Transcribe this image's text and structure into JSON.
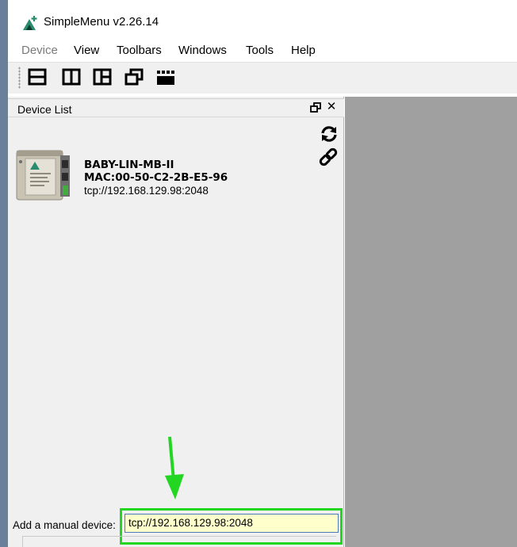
{
  "window": {
    "title": "SimpleMenu v2.26.14"
  },
  "menu": [
    {
      "label": "Device",
      "enabled": false
    },
    {
      "label": "View",
      "enabled": true
    },
    {
      "label": "Toolbars",
      "enabled": true
    },
    {
      "label": "Windows",
      "enabled": true
    },
    {
      "label": "Tools",
      "enabled": true
    },
    {
      "label": "Help",
      "enabled": true
    }
  ],
  "toolbar": {
    "icons": [
      "layout-horizontal-icon",
      "layout-vertical-icon",
      "layout-grid-icon",
      "cascade-windows-icon",
      "clapperboard-icon"
    ]
  },
  "device_list": {
    "title": "Device List",
    "close_glyph": "✕",
    "devices": [
      {
        "name": "BABY-LIN-MB-II",
        "mac": "MAC:00-50-C2-2B-E5-96",
        "address": "tcp://192.168.129.98:2048"
      }
    ],
    "manual": {
      "label": "Add a manual device:",
      "value": "tcp://192.168.129.98:2048"
    }
  },
  "colors": {
    "accent_logo": "#2a8c6e",
    "highlight": "#22d622",
    "input_background": "#ffffcc",
    "workspace": "#a0a0a0"
  }
}
